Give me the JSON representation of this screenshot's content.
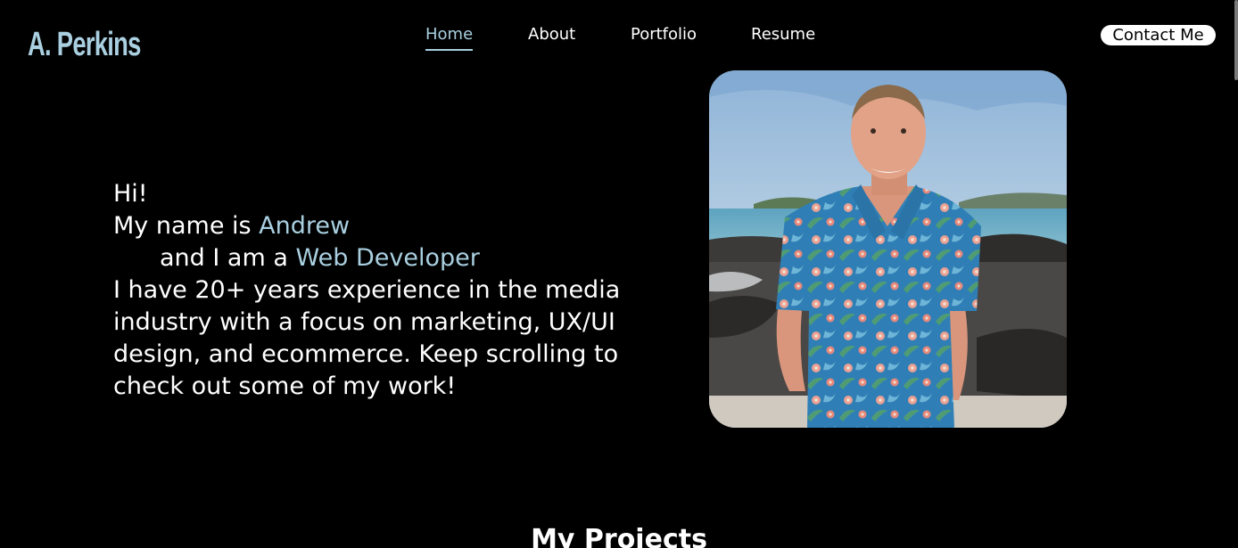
{
  "brand": {
    "logo": "A. Perkins"
  },
  "nav": {
    "items": [
      {
        "label": "Home",
        "active": true
      },
      {
        "label": "About",
        "active": false
      },
      {
        "label": "Portfolio",
        "active": false
      },
      {
        "label": "Resume",
        "active": false
      }
    ],
    "contact_label": "Contact Me"
  },
  "hero": {
    "greeting": "Hi!",
    "name_prefix": "My name is",
    "name": "Andrew",
    "role_prefix": "and I am a",
    "role": "Web Developer",
    "bio": "I have 20+ years experience in the media industry with a focus on marketing, UX/UI design, and ecommerce. Keep scrolling to check out some of my work!"
  },
  "projects": {
    "title": "My Projects"
  },
  "colors": {
    "accent": "#a9cfe0",
    "background": "#000000",
    "text": "#ffffff"
  }
}
